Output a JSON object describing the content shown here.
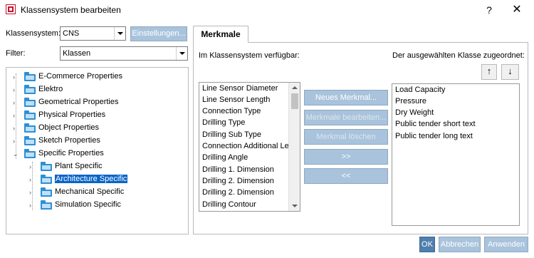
{
  "window": {
    "title": "Klassensystem bearbeiten",
    "help_glyph": "?",
    "close_glyph": "✕"
  },
  "top": {
    "classsystem_label": "Klassensystem:",
    "classsystem_value": "CNS",
    "settings_button": "Einstellungen...",
    "filter_label": "Filter:",
    "filter_value": "Klassen"
  },
  "tree": {
    "items": [
      {
        "label": "E-Commerce Properties"
      },
      {
        "label": "Elektro"
      },
      {
        "label": "Geometrical Properties"
      },
      {
        "label": "Physical Properties"
      },
      {
        "label": "Object Properties"
      },
      {
        "label": "Sketch Properties"
      },
      {
        "label": "Specific Properties"
      },
      {
        "label": "Plant Specific"
      },
      {
        "label": "Architecture Specific"
      },
      {
        "label": "Mechanical Specific"
      },
      {
        "label": "Simulation Specific"
      }
    ]
  },
  "tab": {
    "label": "Merkmale",
    "available_heading": "Im Klassensystem verfügbar:",
    "assigned_heading": "Der ausgewählten Klasse zugeordnet:",
    "available_items": [
      "Line Sensor Diameter",
      "Line Sensor Length",
      "Connection Type",
      "Drilling Type",
      "Drilling Sub Type",
      "Connection Additional Le",
      "Drilling Angle",
      "Drilling 1. Dimension",
      "Drilling 2. Dimension",
      "Drilling 2. Dimension",
      "Drilling Contour"
    ],
    "assigned_items": [
      "Load Capacity",
      "Pressure",
      "Dry Weight",
      "Public tender short text",
      "Public tender long text"
    ],
    "new_button": "Neues Merkmal...",
    "edit_button": "Merkmale bearbeiten...",
    "delete_button": "Merkmal löschen",
    "add_button": ">>",
    "remove_button": "<<",
    "move_up_glyph": "↑",
    "move_down_glyph": "↓"
  },
  "footer": {
    "ok": "OK",
    "cancel": "Abbrechen",
    "apply": "Anwenden"
  }
}
